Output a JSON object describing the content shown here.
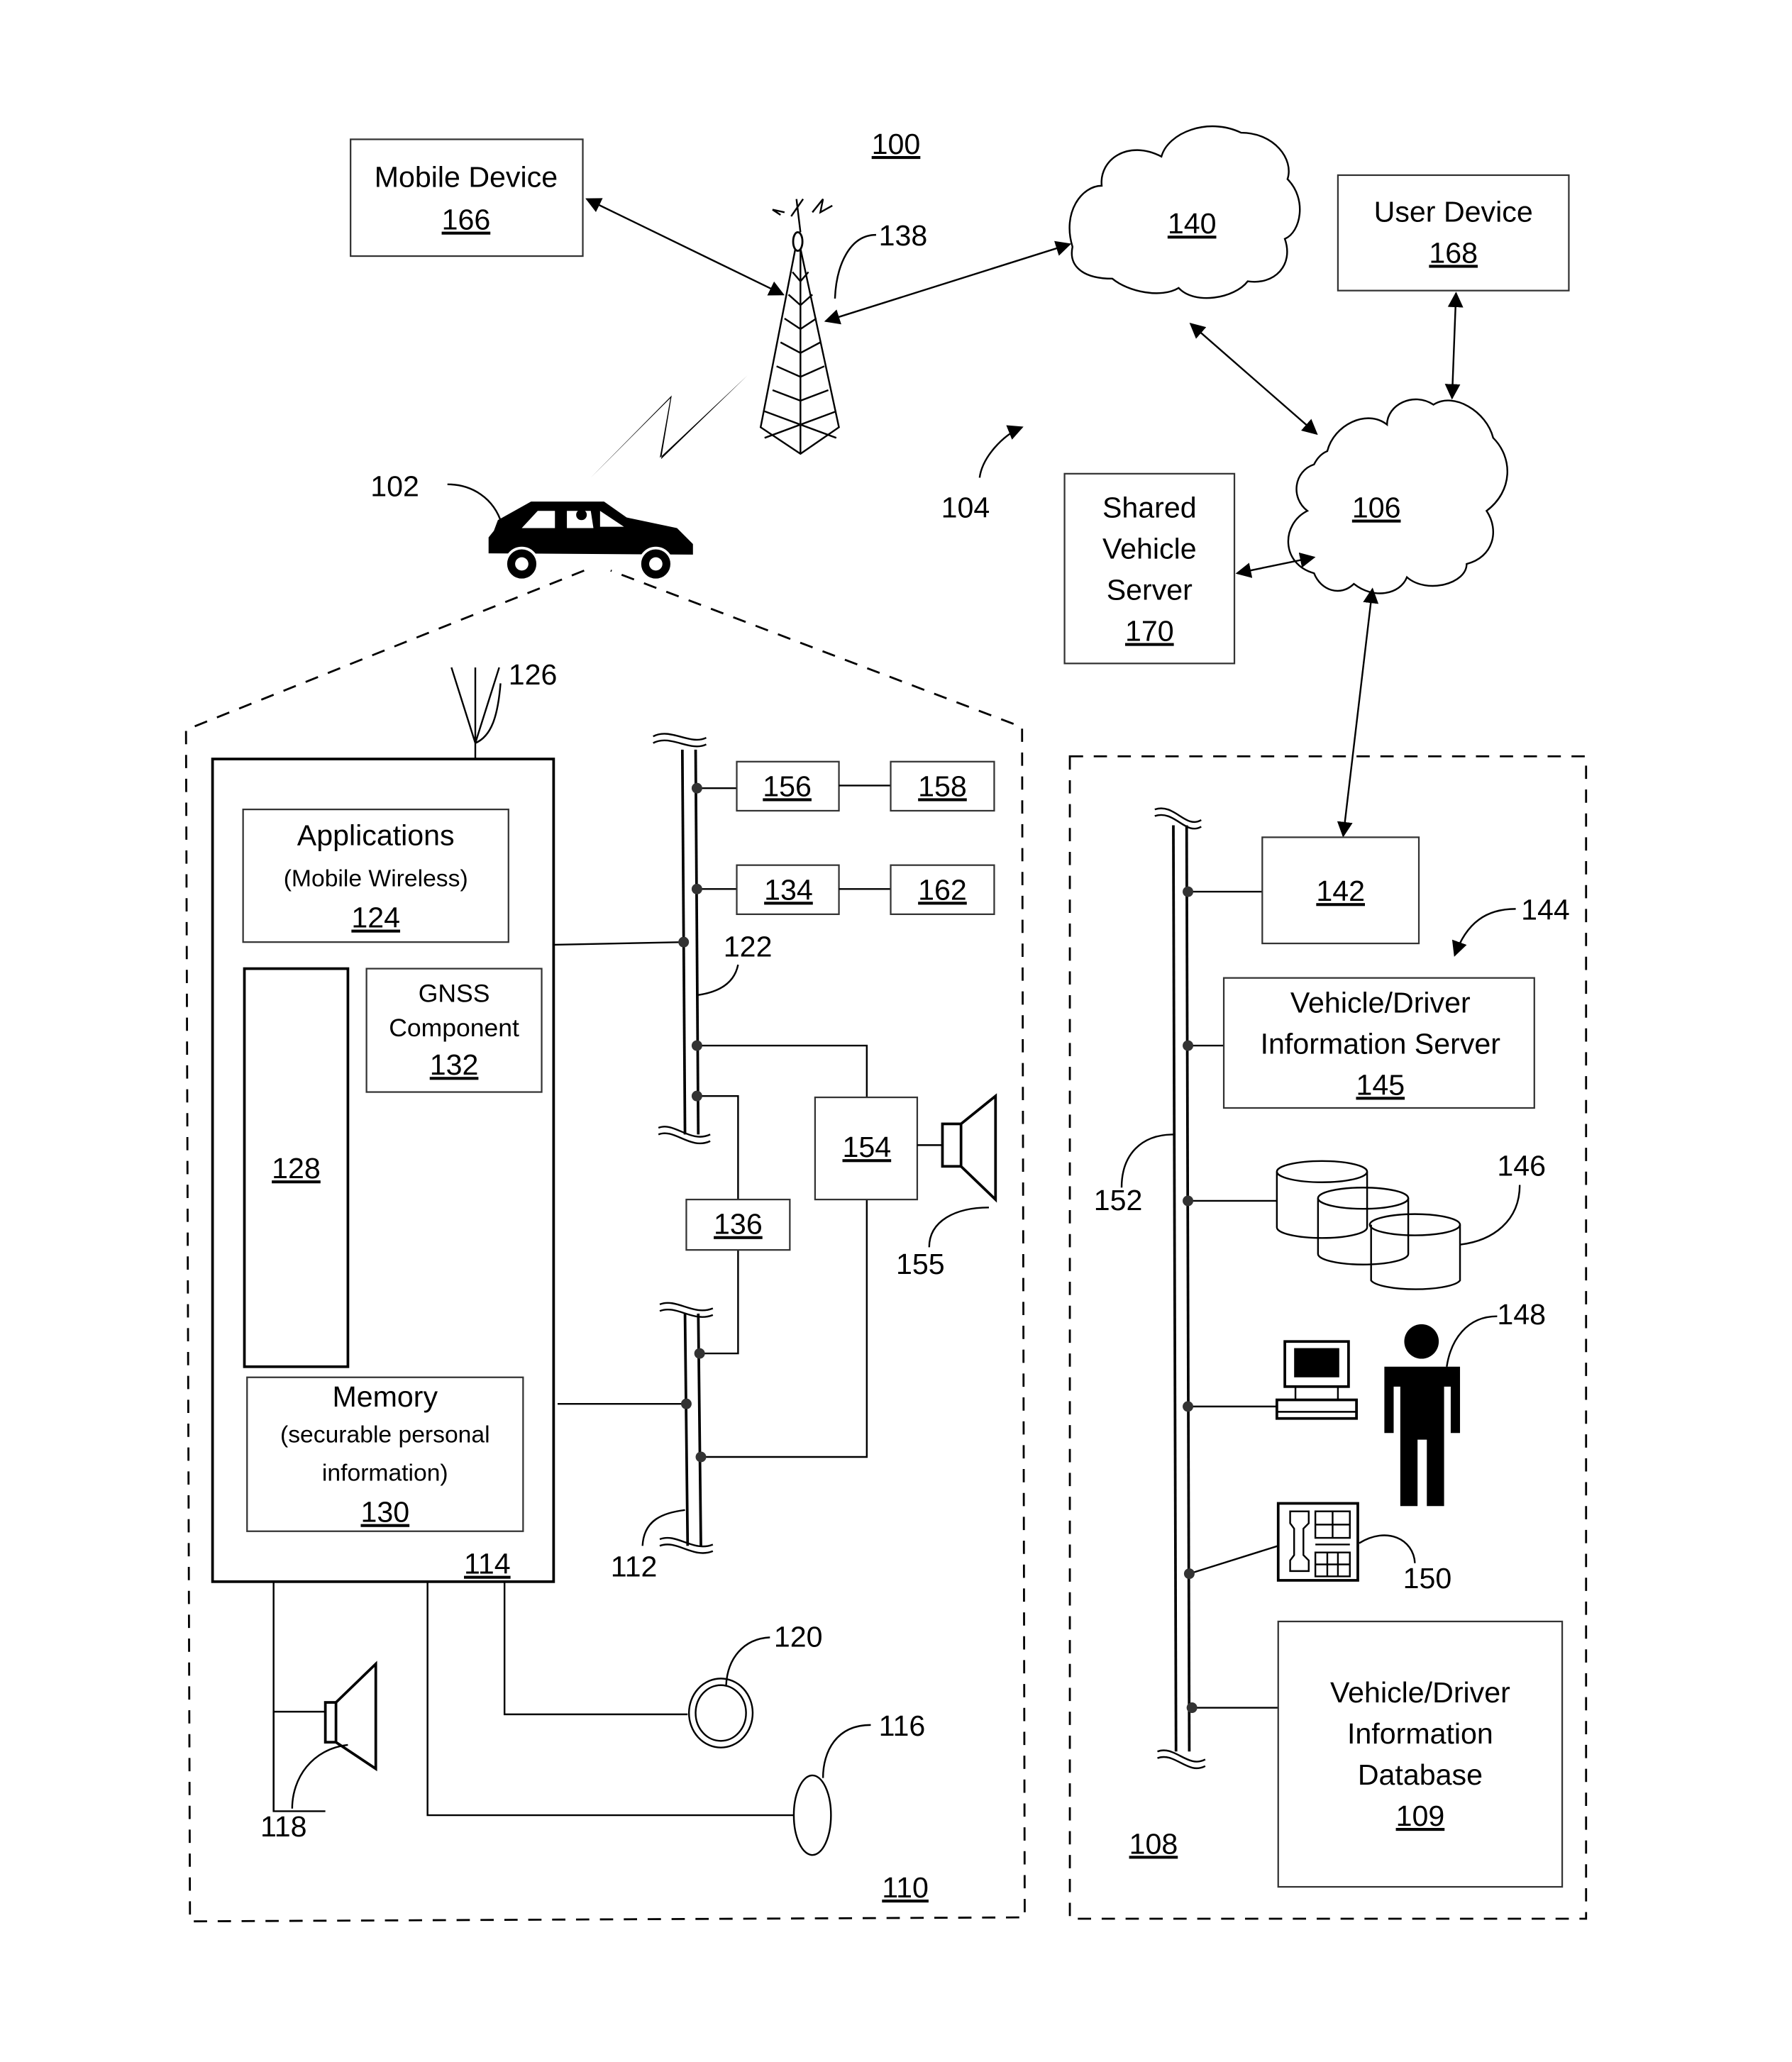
{
  "figure_label": "100",
  "nodes": {
    "mobile_device": {
      "title": "Mobile Device",
      "ref": "166"
    },
    "tower": {
      "ref": "138"
    },
    "cloud_140": {
      "ref": "140"
    },
    "user_device": {
      "title": "User Device",
      "ref": "168"
    },
    "cloud_106": {
      "ref": "106"
    },
    "shared_vehicle_server": {
      "lines": [
        "Shared",
        "Vehicle",
        "Server"
      ],
      "ref": "170"
    },
    "vehicle": {
      "ref": "102"
    },
    "link_104": {
      "ref": "104"
    },
    "antenna": {
      "ref": "126"
    },
    "applications": {
      "title": "Applications",
      "subtitle": "(Mobile Wireless)",
      "ref": "124"
    },
    "gnss": {
      "lines": [
        "GNSS",
        "Component"
      ],
      "ref": "132"
    },
    "block_128": {
      "ref": "128"
    },
    "memory": {
      "title": "Memory",
      "lines": [
        "(securable personal",
        "information)"
      ],
      "ref": "130"
    },
    "telematics_unit": {
      "ref": "114"
    },
    "bus_122": {
      "ref": "122"
    },
    "bus_112": {
      "ref": "112"
    },
    "box_156": {
      "ref": "156"
    },
    "box_158": {
      "ref": "158"
    },
    "box_134": {
      "ref": "134"
    },
    "box_162": {
      "ref": "162"
    },
    "box_136": {
      "ref": "136"
    },
    "box_154": {
      "ref": "154"
    },
    "speaker_155": {
      "ref": "155"
    },
    "speaker_118": {
      "ref": "118"
    },
    "button_120": {
      "ref": "120"
    },
    "microphone_116": {
      "ref": "116"
    },
    "vehicle_region": {
      "ref": "110"
    },
    "box_142": {
      "ref": "142"
    },
    "system_144": {
      "ref": "144"
    },
    "vd_info_server": {
      "lines": [
        "Vehicle/Driver",
        "Information Server"
      ],
      "ref": "145"
    },
    "databases": {
      "ref": "146"
    },
    "live_advisor": {
      "ref": "148"
    },
    "telephone": {
      "ref": "150"
    },
    "network_152": {
      "ref": "152"
    },
    "vd_info_database": {
      "lines": [
        "Vehicle/Driver",
        "Information",
        "Database"
      ],
      "ref": "109"
    },
    "call_center_region": {
      "ref": "108"
    }
  }
}
